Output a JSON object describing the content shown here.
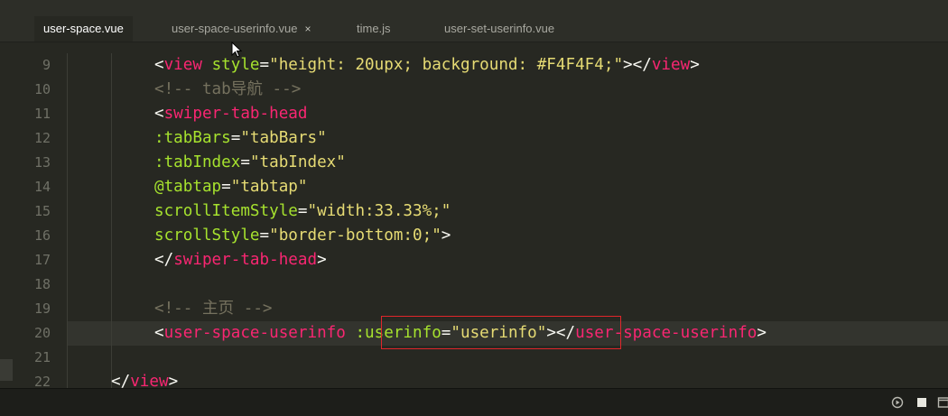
{
  "tabs": [
    {
      "label": "user-space.vue",
      "active": true
    },
    {
      "label": "user-space-userinfo.vue",
      "close": "×"
    },
    {
      "label": "time.js"
    },
    {
      "label": "user-set-userinfo.vue"
    }
  ],
  "lines": [
    {
      "num": "9",
      "tokens": [
        "<",
        "view",
        " ",
        "style",
        "=",
        "\"height: 20upx; background: #F4F4F4;\"",
        "></",
        "view",
        ">"
      ]
    },
    {
      "num": "10",
      "tokens": [
        "<!-- tab导航 -->"
      ]
    },
    {
      "num": "11",
      "tokens": [
        "<",
        "swiper-tab-head"
      ]
    },
    {
      "num": "12",
      "tokens": [
        ":tabBars",
        "=",
        "\"tabBars\""
      ]
    },
    {
      "num": "13",
      "tokens": [
        ":tabIndex",
        "=",
        "\"tabIndex\""
      ]
    },
    {
      "num": "14",
      "tokens": [
        "@tabtap",
        "=",
        "\"tabtap\""
      ]
    },
    {
      "num": "15",
      "tokens": [
        "scrollItemStyle",
        "=",
        "\"width:33.33%;\""
      ]
    },
    {
      "num": "16",
      "tokens": [
        "scrollStyle",
        "=",
        "\"border-bottom:0;\"",
        ">"
      ]
    },
    {
      "num": "17",
      "tokens": [
        "</",
        "swiper-tab-head",
        ">"
      ]
    },
    {
      "num": "18",
      "tokens": []
    },
    {
      "num": "19",
      "tokens": [
        "<!-- 主页 -->"
      ]
    },
    {
      "num": "20",
      "tokens": [
        "<",
        "user-space-userinfo",
        " ",
        ":userinfo",
        "=",
        "\"userinfo\"",
        "></",
        "user-space-userinfo",
        ">"
      ]
    },
    {
      "num": "21",
      "tokens": []
    },
    {
      "num": "22",
      "tokens": [
        "</",
        "view",
        ">"
      ]
    }
  ],
  "colors": {
    "background": "#272822",
    "tag": "#f92672",
    "attribute": "#a6e22e",
    "string": "#e6db74",
    "comment": "#75715e",
    "highlight_border": "#e0262b"
  },
  "status_icons": [
    "run-icon",
    "stop-icon",
    "window-icon"
  ]
}
